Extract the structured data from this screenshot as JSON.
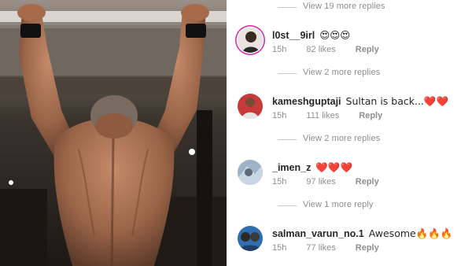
{
  "comments_panel": {
    "view_more": [
      "View 19 more replies",
      "View 2 more replies",
      "View 2 more replies",
      "View 1 more reply"
    ],
    "items": [
      {
        "username": "l0st__9irl",
        "text": "😍😍😍",
        "time": "15h",
        "likes": "82 likes",
        "reply": "Reply"
      },
      {
        "username": "kameshguptaji",
        "text": "Sultan is back...❤️❤️",
        "time": "15h",
        "likes": "111 likes",
        "reply": "Reply"
      },
      {
        "username": "_imen_z",
        "text": "❤️❤️❤️",
        "time": "15h",
        "likes": "97 likes",
        "reply": "Reply"
      },
      {
        "username": "salman_varun_no.1",
        "text": "Awesome🔥🔥🔥",
        "time": "15h",
        "likes": "77 likes",
        "reply": "Reply"
      }
    ]
  },
  "colors": {
    "secondary_text": "#8e8e8e",
    "primary_text": "#262626",
    "story_ring": "#d6249f"
  }
}
